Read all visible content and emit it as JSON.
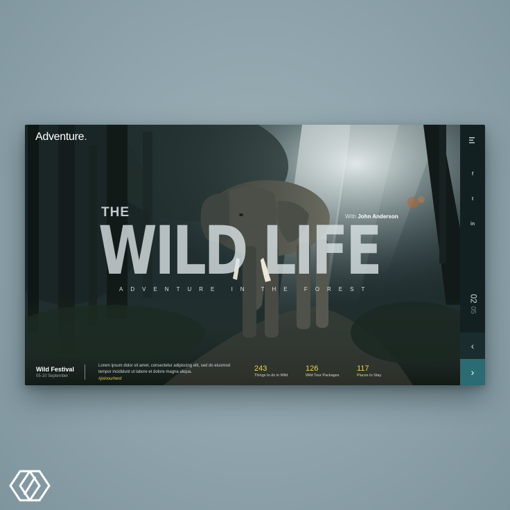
{
  "logo": {
    "text": "Adventure",
    "dot": "."
  },
  "hero": {
    "the": "THE",
    "main": "WILD LIFE",
    "with_prefix": "With ",
    "with_name": "John Anderson",
    "subtitle": "ADVENTURE IN THE FOREST"
  },
  "festival": {
    "name": "Wild Festival",
    "date": "05-10 September"
  },
  "description": "Lorem ipsum dolor sit amet, consectetur adipiscing elit, sed do eiusmod tempor incididunt ut labore et dolore magna aliqua.",
  "hashtag": "#joinourherd",
  "stats": [
    {
      "value": "243",
      "label": "Things to do in Wild"
    },
    {
      "value": "126",
      "label": "Wild Tour Packages"
    },
    {
      "value": "117",
      "label": "Places to Stay"
    }
  ],
  "rail": {
    "menu_icon": "hamburger-icon",
    "social": [
      "f",
      "t",
      "in"
    ],
    "slide_current": "02",
    "slide_total": "05",
    "prev_icon": "chevron-left-icon",
    "next_icon": "chevron-right-icon",
    "prev_glyph": "‹",
    "next_glyph": "›"
  },
  "colors": {
    "accent": "#e6d24a",
    "next_button": "#2b6b74",
    "rail": "#132022"
  }
}
